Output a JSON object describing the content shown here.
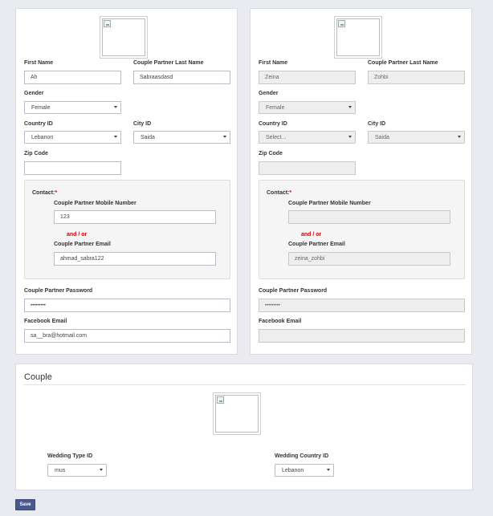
{
  "left_form": {
    "first_name_label": "First Name",
    "first_name_value": "Ah",
    "partner_last_name_label": "Couple Partner Last Name",
    "partner_last_name_value": "Sabraasdasd",
    "gender_label": "Gender",
    "gender_value": "Female",
    "country_label": "Country ID",
    "country_value": "Lebanon",
    "city_label": "City ID",
    "city_value": "Saida",
    "zip_label": "Zip Code",
    "zip_value": "",
    "contact_label": "Contact:",
    "contact_required": "*",
    "mobile_label": "Couple Partner Mobile Number",
    "mobile_value": "123",
    "and_or": "and / or",
    "email_label": "Couple Partner Email",
    "email_value": "ahmad_sabra122",
    "password_label": "Couple Partner Password",
    "password_value": "•••••••••",
    "facebook_label": "Facebook Email",
    "facebook_value": "sa__bra@hotmail.com"
  },
  "right_form": {
    "first_name_label": "First Name",
    "first_name_value": "Zeina",
    "partner_last_name_label": "Couple Partner Last Name",
    "partner_last_name_value": "Zohbi",
    "gender_label": "Gender",
    "gender_value": "Female",
    "country_label": "Country ID",
    "country_value": "Select...",
    "city_label": "City ID",
    "city_value": "Saida",
    "zip_label": "Zip Code",
    "zip_value": "",
    "contact_label": "Contact:",
    "contact_required": "*",
    "mobile_label": "Couple Partner Mobile Number",
    "mobile_value": "",
    "and_or": "and / or",
    "email_label": "Couple Partner Email",
    "email_value": "zeina_zohbi",
    "password_label": "Couple Partner Password",
    "password_value": "•••••••••",
    "facebook_label": "Facebook Email",
    "facebook_value": ""
  },
  "couple": {
    "title": "Couple",
    "wedding_type_label": "Wedding Type ID",
    "wedding_type_value": "mus",
    "wedding_country_label": "Wedding Country ID",
    "wedding_country_value": "Lebanon"
  },
  "actions": {
    "save_label": "Save"
  },
  "colors": {
    "page_bg": "#e9ebf1",
    "required": "#cc0000",
    "save_button": "#4a5a8c"
  }
}
